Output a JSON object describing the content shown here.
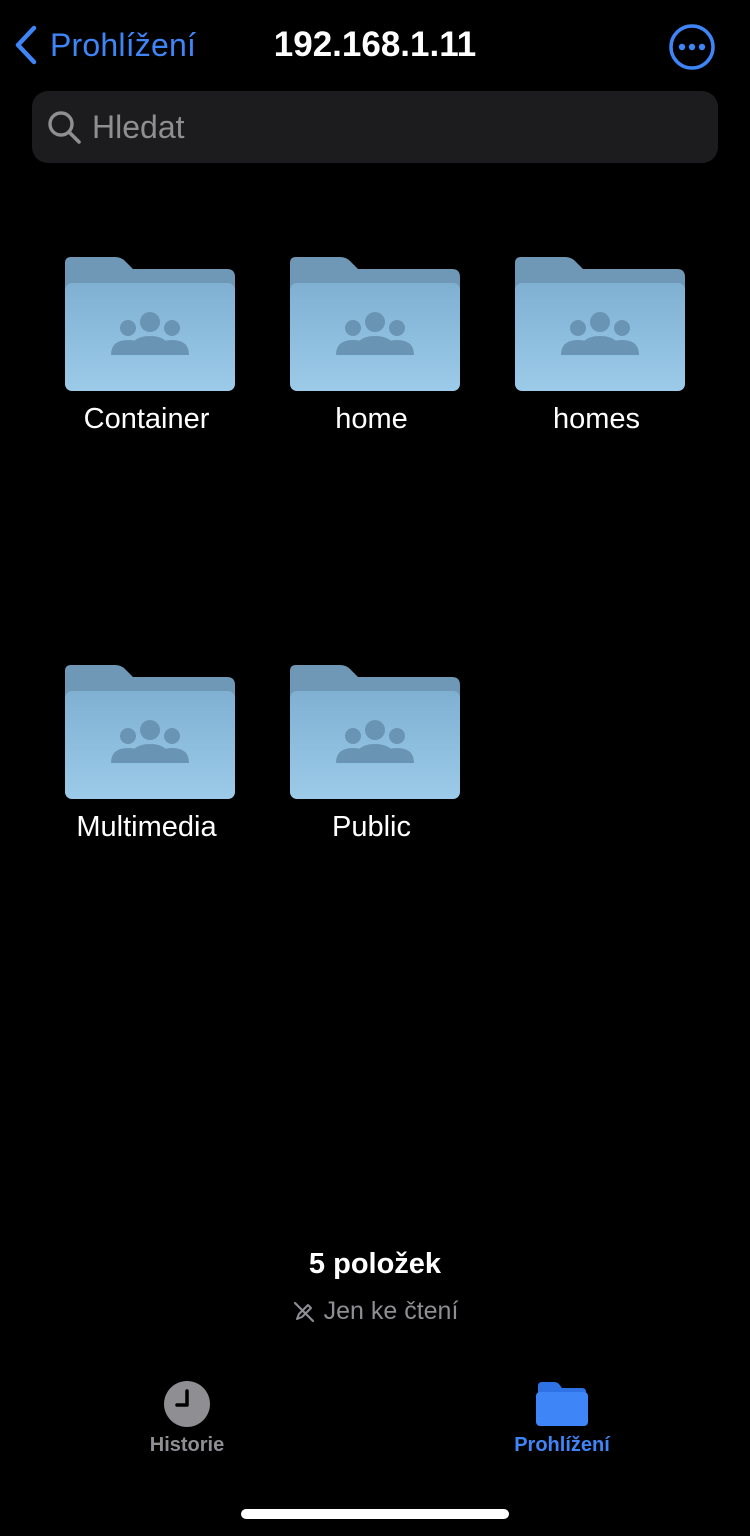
{
  "nav": {
    "back_label": "Prohlížení",
    "title": "192.168.1.11",
    "more_icon": "ellipsis-circle-icon"
  },
  "search": {
    "placeholder": "Hledat",
    "icon": "magnifying-glass-icon"
  },
  "folders": [
    {
      "name": "Container",
      "icon": "shared-folder-icon"
    },
    {
      "name": "home",
      "icon": "shared-folder-icon"
    },
    {
      "name": "homes",
      "icon": "shared-folder-icon"
    },
    {
      "name": "Multimedia",
      "icon": "shared-folder-icon"
    },
    {
      "name": "Public",
      "icon": "shared-folder-icon"
    }
  ],
  "footer": {
    "count": "5 položek",
    "readonly": "Jen ke čtení",
    "readonly_icon": "pencil-slash-icon"
  },
  "tabbar": {
    "tabs": [
      {
        "label": "Historie",
        "icon": "clock-icon",
        "active": false
      },
      {
        "label": "Prohlížení",
        "icon": "folder-icon",
        "active": true
      }
    ]
  },
  "colors": {
    "accent": "#3e85f7",
    "background": "#000000",
    "search_bg": "#1c1c1e",
    "secondary_text": "#8e8e93",
    "folder_light": "#8fc0e0",
    "folder_dark": "#6f9cbb",
    "tab_inactive": "#8e8e93"
  }
}
